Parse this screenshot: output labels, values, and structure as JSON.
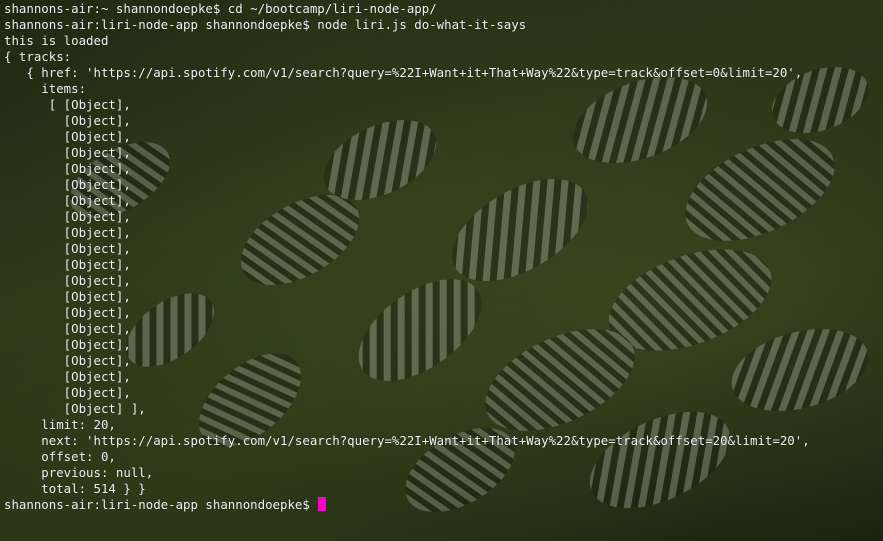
{
  "terminal": {
    "cursor_color": "#ff00c8",
    "text_color": "#f2f2f2",
    "lines": [
      "shannons-air:~ shannondoepke$ cd ~/bootcamp/liri-node-app/",
      "shannons-air:liri-node-app shannondoepke$ node liri.js do-what-it-says",
      "this is loaded",
      "{ tracks:",
      "   { href: 'https://api.spotify.com/v1/search?query=%22I+Want+it+That+Way%22&type=track&offset=0&limit=20',",
      "     items:",
      "      [ [Object],",
      "        [Object],",
      "        [Object],",
      "        [Object],",
      "        [Object],",
      "        [Object],",
      "        [Object],",
      "        [Object],",
      "        [Object],",
      "        [Object],",
      "        [Object],",
      "        [Object],",
      "        [Object],",
      "        [Object],",
      "        [Object],",
      "        [Object],",
      "        [Object],",
      "        [Object],",
      "        [Object],",
      "        [Object] ],",
      "     limit: 20,",
      "     next: 'https://api.spotify.com/v1/search?query=%22I+Want+it+That+Way%22&type=track&offset=20&limit=20',",
      "     offset: 0,",
      "     previous: null,",
      "     total: 514 } }"
    ],
    "prompt": "shannons-air:liri-node-app shannondoepke$ "
  }
}
